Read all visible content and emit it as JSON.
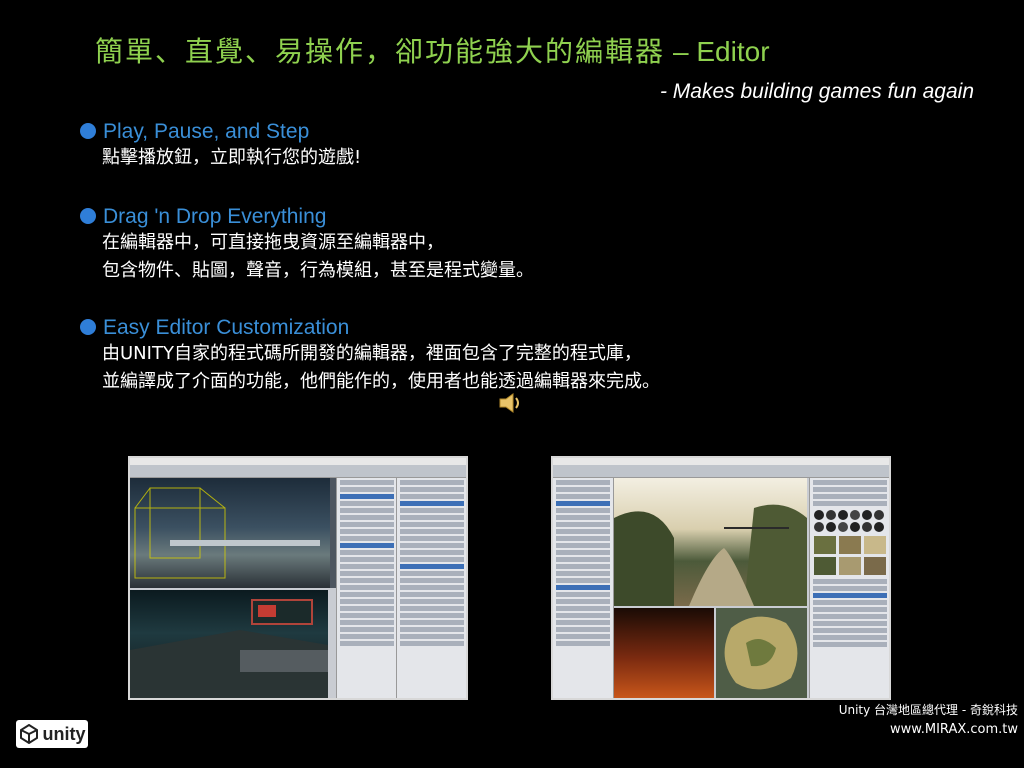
{
  "title": {
    "main": "簡單、直覺、易操作，卻功能強大的編輯器",
    "suffix": "– Editor"
  },
  "subtitle": "- Makes building games fun again",
  "bullets": [
    {
      "heading": "Play, Pause, and Step",
      "lines": [
        "點擊播放鈕，立即執行您的遊戲!"
      ]
    },
    {
      "heading": "Drag 'n Drop Everything",
      "lines": [
        "在編輯器中，可直接拖曳資源至編輯器中，",
        "包含物件、貼圖，聲音，行為模組，甚至是程式變量。"
      ]
    },
    {
      "heading": "Easy Editor Customization",
      "lines": [
        "由UNITY自家的程式碼所開發的編輯器，裡面包含了完整的程式庫，",
        "並編譯成了介面的功能，他們能作的，使用者也能透過編輯器來完成。"
      ]
    }
  ],
  "logo": "unity",
  "footer": {
    "line1": "Unity 台灣地區總代理 - 奇銳科技",
    "url": "www.MIRAX.com.tw"
  },
  "colors": {
    "title": "#8fd14f",
    "heading": "#3a8fd8",
    "background": "#000000"
  },
  "icons": [
    "bullet-dot-icon",
    "speaker-icon",
    "unity-logo-icon"
  ]
}
